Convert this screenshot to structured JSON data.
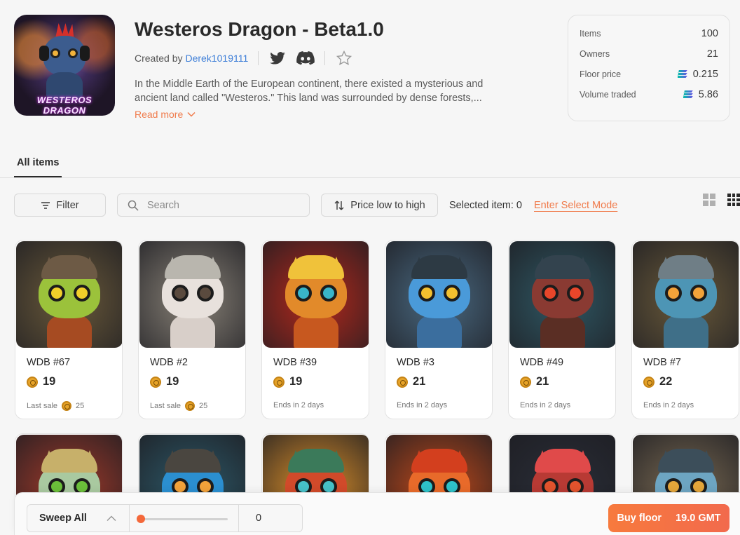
{
  "collection": {
    "title": "Westeros Dragon - Beta1.0",
    "created_by_label": "Created by",
    "creator": "Derek1019111",
    "cover_text": "WESTEROS DRAGON",
    "description": "In the Middle Earth of the European continent, there existed a mysterious and ancient land called \"Westeros.\" This land was surrounded by dense forests,...",
    "read_more": "Read more"
  },
  "stats": [
    {
      "label": "Items",
      "value": "100",
      "currency": false
    },
    {
      "label": "Owners",
      "value": "21",
      "currency": false
    },
    {
      "label": "Floor price",
      "value": "0.215",
      "currency": true
    },
    {
      "label": "Volume traded",
      "value": "5.86",
      "currency": true
    }
  ],
  "tabs": [
    {
      "label": "All items",
      "active": true
    }
  ],
  "toolbar": {
    "filter_label": "Filter",
    "search_placeholder": "Search",
    "sort_label": "Price low to high",
    "selected_text": "Selected item: 0",
    "select_mode": "Enter Select Mode"
  },
  "items": [
    {
      "name": "WDB #67",
      "price": "19",
      "foot_label": "Last sale",
      "foot_price": "25",
      "palette": {
        "bg": "#6b5a3a",
        "head": "#9bc23b",
        "eye": "#f2cf2a",
        "helmet": "#6d5a45",
        "body": "#a64b22"
      }
    },
    {
      "name": "WDB #2",
      "price": "19",
      "foot_label": "Last sale",
      "foot_price": "25",
      "palette": {
        "bg": "#8a8378",
        "head": "#e8e1dc",
        "eye": "#5a4a3e",
        "helmet": "#b9b6ae",
        "body": "#d8cfc9"
      }
    },
    {
      "name": "WDB #39",
      "price": "19",
      "foot_label": "Ends in 2 days",
      "foot_price": "",
      "palette": {
        "bg": "#b5281c",
        "head": "#e28a2a",
        "eye": "#39b5c9",
        "helmet": "#f0c23a",
        "body": "#c7581f"
      }
    },
    {
      "name": "WDB #3",
      "price": "21",
      "foot_label": "Ends in 2 days",
      "foot_price": "",
      "palette": {
        "bg": "#4a6a82",
        "head": "#4a9ad9",
        "eye": "#f3c02f",
        "helmet": "#2d3a44",
        "body": "#3b6e9e"
      }
    },
    {
      "name": "WDB #49",
      "price": "21",
      "foot_label": "Ends in 2 days",
      "foot_price": "",
      "palette": {
        "bg": "#2f5864",
        "head": "#8a3a32",
        "eye": "#e8462a",
        "helmet": "#33434e",
        "body": "#5a2e24"
      }
    },
    {
      "name": "WDB #7",
      "price": "22",
      "foot_label": "Ends in 2 days",
      "foot_price": "",
      "palette": {
        "bg": "#6a5a3a",
        "head": "#4d95b5",
        "eye": "#f2a23a",
        "helmet": "#6f7e86",
        "body": "#3f6f88"
      }
    },
    {
      "palette": {
        "bg": "#a43a2a",
        "head": "#a9c9a0",
        "eye": "#6bbf3a",
        "helmet": "#c7b06a",
        "body": "#8ea388"
      }
    },
    {
      "palette": {
        "bg": "#2d5a6a",
        "head": "#2b8fd0",
        "eye": "#f2a23a",
        "helmet": "#4a4640",
        "body": "#2a6a95"
      }
    },
    {
      "palette": {
        "bg": "#e0922a",
        "head": "#d14a2a",
        "eye": "#46c0c8",
        "helmet": "#3b7a5a",
        "body": "#b23a22"
      }
    },
    {
      "palette": {
        "bg": "#c44a1a",
        "head": "#e86a2a",
        "eye": "#2ec2c9",
        "helmet": "#d33f1e",
        "body": "#c2471e"
      }
    },
    {
      "palette": {
        "bg": "#2a2e38",
        "head": "#b83a34",
        "eye": "#e2532d",
        "helmet": "#e04a4a",
        "body": "#7a2a26"
      }
    },
    {
      "palette": {
        "bg": "#7a6a52",
        "head": "#6da5c2",
        "eye": "#e4a63a",
        "helmet": "#3c4e5a",
        "body": "#4e7e98"
      }
    }
  ],
  "bottom": {
    "sweep_label": "Sweep All",
    "sweep_count": "0",
    "sweep_level": 0,
    "buy_label": "Buy floor",
    "buy_price": "19.0 GMT"
  },
  "colors": {
    "accent": "#f07a4a",
    "link": "#3f7fd8"
  }
}
